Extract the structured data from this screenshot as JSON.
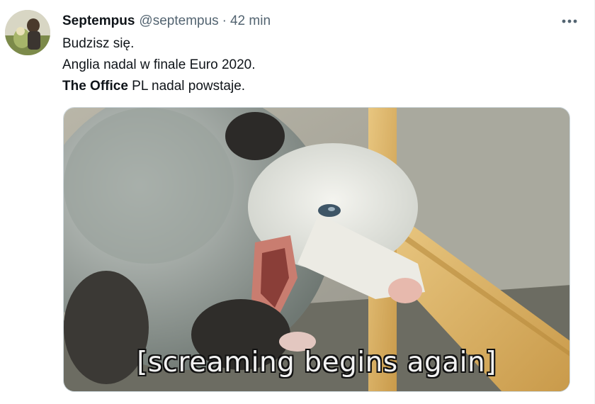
{
  "tweet": {
    "author": {
      "display_name": "Septempus",
      "handle": "@septempus",
      "separator": "·",
      "time": "42 min"
    },
    "more_icon": "more-horizontal-icon",
    "text": {
      "line1": "Budzisz się.",
      "line2": "Anglia nadal w finale Euro 2020.",
      "line3_bold": "The Office",
      "line3_rest": " PL nadal powstaje."
    },
    "media": {
      "caption": "[screaming begins again]"
    }
  },
  "colors": {
    "text_primary": "#0f1419",
    "text_secondary": "#536471",
    "border": "#cfd9de"
  }
}
